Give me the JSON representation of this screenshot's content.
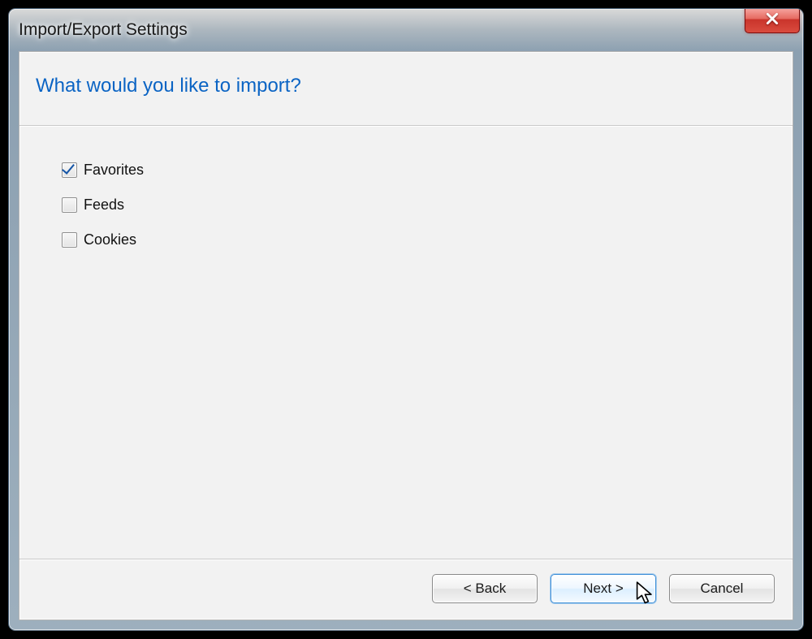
{
  "window": {
    "title": "Import/Export Settings"
  },
  "header": {
    "heading": "What would you like to import?"
  },
  "options": [
    {
      "label": "Favorites",
      "checked": true
    },
    {
      "label": "Feeds",
      "checked": false
    },
    {
      "label": "Cookies",
      "checked": false
    }
  ],
  "footer": {
    "back": "< Back",
    "next": "Next >",
    "cancel": "Cancel"
  }
}
